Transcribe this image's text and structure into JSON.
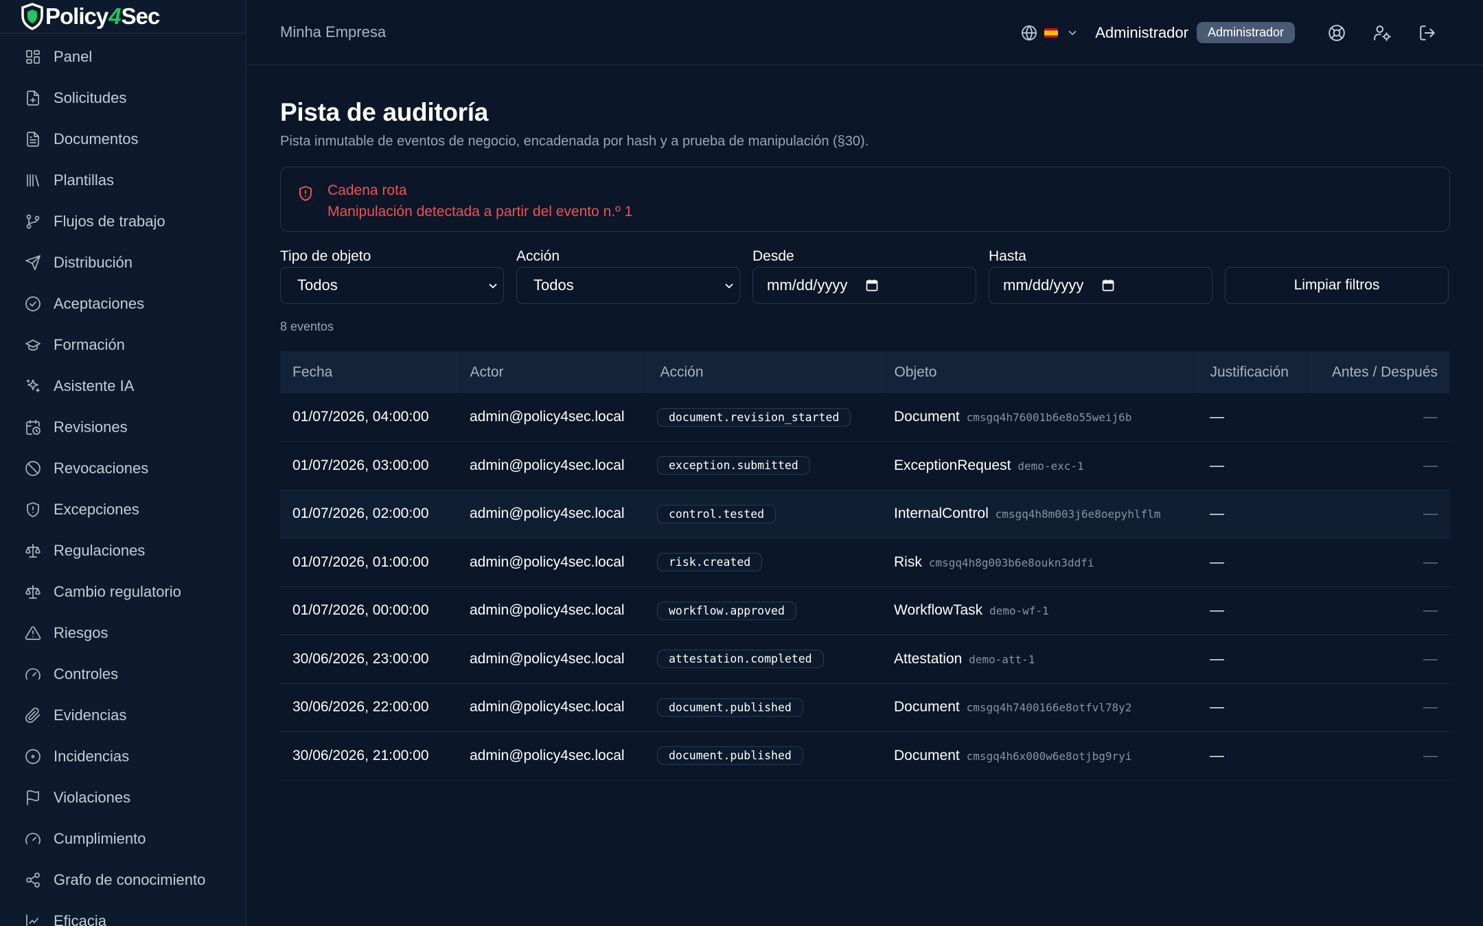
{
  "brand": {
    "part1": "Policy",
    "part2": "4",
    "part3": "Sec"
  },
  "sidebar": {
    "items": [
      {
        "label": "Panel",
        "icon": "dashboard-icon"
      },
      {
        "label": "Solicitudes",
        "icon": "file-plus-icon"
      },
      {
        "label": "Documentos",
        "icon": "file-text-icon"
      },
      {
        "label": "Plantillas",
        "icon": "library-icon"
      },
      {
        "label": "Flujos de trabajo",
        "icon": "git-branch-icon"
      },
      {
        "label": "Distribución",
        "icon": "send-icon"
      },
      {
        "label": "Aceptaciones",
        "icon": "check-circle-icon"
      },
      {
        "label": "Formación",
        "icon": "graduation-cap-icon"
      },
      {
        "label": "Asistente IA",
        "icon": "sparkles-icon"
      },
      {
        "label": "Revisiones",
        "icon": "calendar-clock-icon"
      },
      {
        "label": "Revocaciones",
        "icon": "ban-icon"
      },
      {
        "label": "Excepciones",
        "icon": "shield-alert-icon"
      },
      {
        "label": "Regulaciones",
        "icon": "scale-icon"
      },
      {
        "label": "Cambio regulatorio",
        "icon": "scale-icon"
      },
      {
        "label": "Riesgos",
        "icon": "alert-triangle-icon"
      },
      {
        "label": "Controles",
        "icon": "gauge-icon"
      },
      {
        "label": "Evidencias",
        "icon": "paperclip-icon"
      },
      {
        "label": "Incidencias",
        "icon": "circle-dot-icon"
      },
      {
        "label": "Violaciones",
        "icon": "flag-icon"
      },
      {
        "label": "Cumplimiento",
        "icon": "gauge-icon"
      },
      {
        "label": "Grafo de conocimiento",
        "icon": "share-icon"
      },
      {
        "label": "Eficacia",
        "icon": "chart-icon"
      }
    ]
  },
  "header": {
    "org": "Minha Empresa",
    "user": "Administrador",
    "role": "Administrador",
    "language_flag": "es"
  },
  "page": {
    "title": "Pista de auditoría",
    "subtitle": "Pista inmutable de eventos de negocio, encadenada por hash y a prueba de manipulación (§30)."
  },
  "alert": {
    "title": "Cadena rota",
    "message": "Manipulación detectada a partir del evento n.º 1",
    "color": "#f05252"
  },
  "filters": {
    "object_type": {
      "label": "Tipo de objeto",
      "value": "Todos"
    },
    "action": {
      "label": "Acción",
      "value": "Todos"
    },
    "from": {
      "label": "Desde",
      "placeholder": "mm/dd/yyyy"
    },
    "to": {
      "label": "Hasta",
      "placeholder": "mm/dd/yyyy"
    },
    "clear_label": "Limpiar filtros"
  },
  "count_label": "8 eventos",
  "table": {
    "columns": [
      "Fecha",
      "Actor",
      "Acción",
      "Objeto",
      "Justificación",
      "Antes / Después"
    ],
    "rows": [
      {
        "date": "01/07/2026, 04:00:00",
        "actor": "admin@policy4sec.local",
        "action": "document.revision_started",
        "object_type": "Document",
        "object_id": "cmsgq4h76001b6e8o55weij6b",
        "justification": "—",
        "diff": "—"
      },
      {
        "date": "01/07/2026, 03:00:00",
        "actor": "admin@policy4sec.local",
        "action": "exception.submitted",
        "object_type": "ExceptionRequest",
        "object_id": "demo-exc-1",
        "justification": "—",
        "diff": "—"
      },
      {
        "date": "01/07/2026, 02:00:00",
        "actor": "admin@policy4sec.local",
        "action": "control.tested",
        "object_type": "InternalControl",
        "object_id": "cmsgq4h8m003j6e8oepyhlflm",
        "justification": "—",
        "diff": "—"
      },
      {
        "date": "01/07/2026, 01:00:00",
        "actor": "admin@policy4sec.local",
        "action": "risk.created",
        "object_type": "Risk",
        "object_id": "cmsgq4h8g003b6e8oukn3ddfi",
        "justification": "—",
        "diff": "—"
      },
      {
        "date": "01/07/2026, 00:00:00",
        "actor": "admin@policy4sec.local",
        "action": "workflow.approved",
        "object_type": "WorkflowTask",
        "object_id": "demo-wf-1",
        "justification": "—",
        "diff": "—"
      },
      {
        "date": "30/06/2026, 23:00:00",
        "actor": "admin@policy4sec.local",
        "action": "attestation.completed",
        "object_type": "Attestation",
        "object_id": "demo-att-1",
        "justification": "—",
        "diff": "—"
      },
      {
        "date": "30/06/2026, 22:00:00",
        "actor": "admin@policy4sec.local",
        "action": "document.published",
        "object_type": "Document",
        "object_id": "cmsgq4h7400166e8otfvl78y2",
        "justification": "—",
        "diff": "—"
      },
      {
        "date": "30/06/2026, 21:00:00",
        "actor": "admin@policy4sec.local",
        "action": "document.published",
        "object_type": "Document",
        "object_id": "cmsgq4h6x000w6e8otjbg9ryi",
        "justification": "—",
        "diff": "—"
      }
    ]
  }
}
